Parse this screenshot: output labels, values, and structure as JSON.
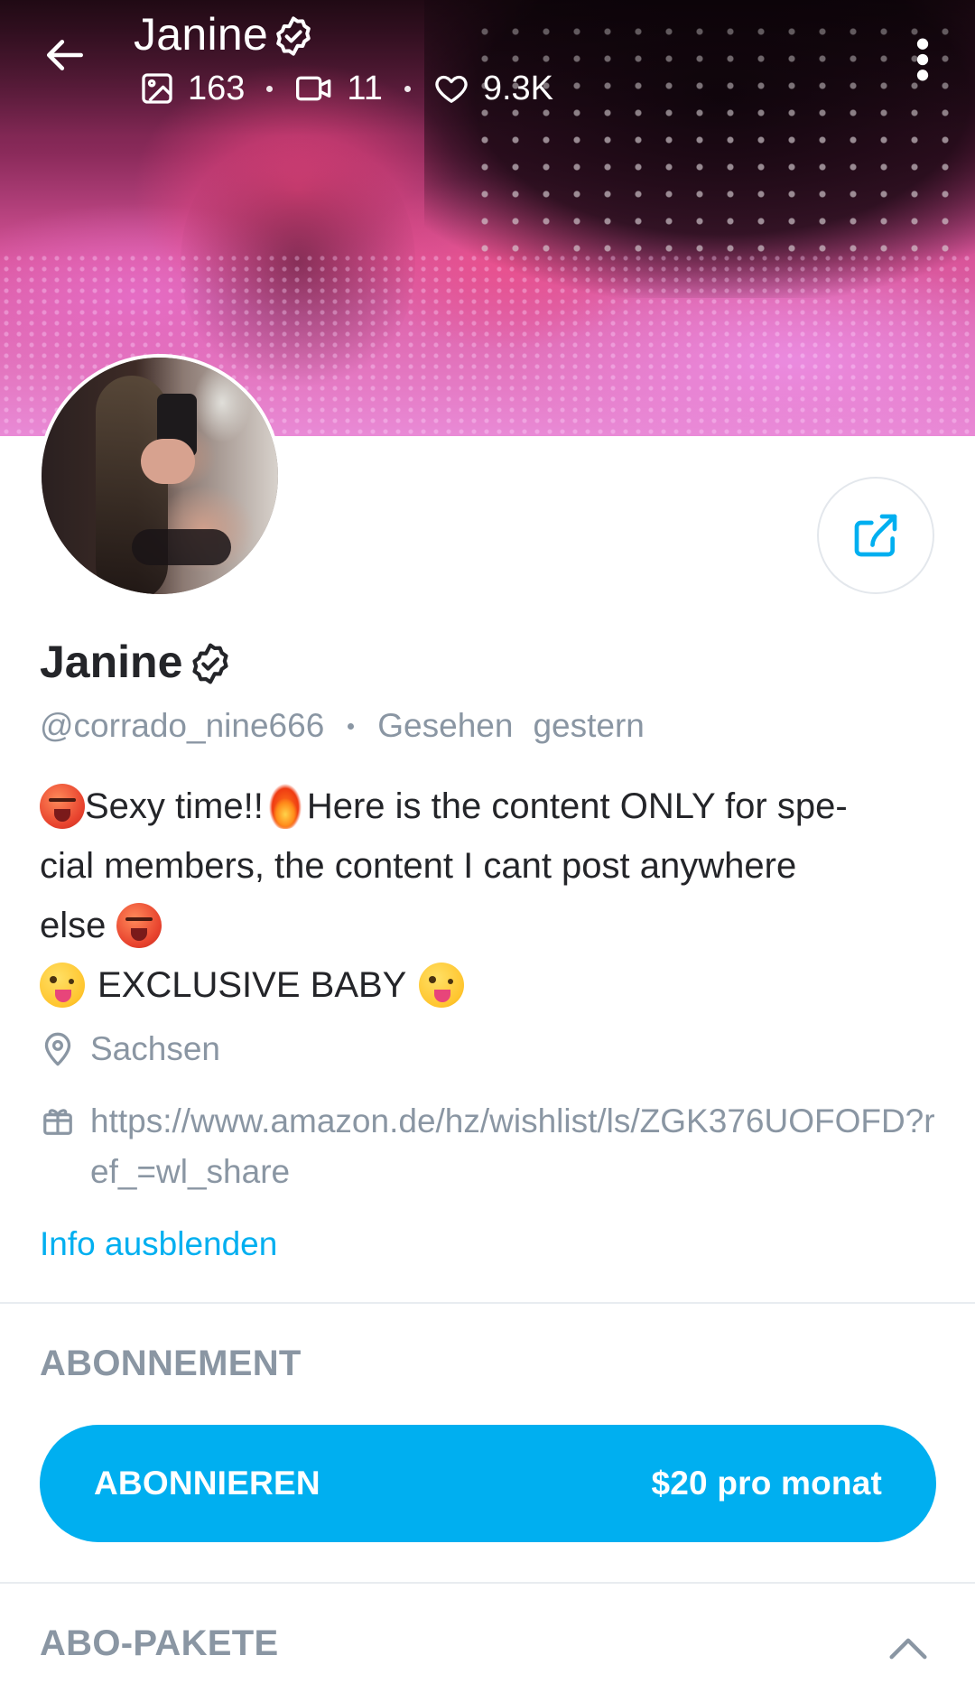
{
  "header": {
    "name": "Janine",
    "stats": {
      "photos": "163",
      "videos": "11",
      "likes": "9.3K"
    }
  },
  "profile": {
    "name": "Janine",
    "handle": "@corrado_nine666",
    "seen_label": "Gesehen",
    "seen_when": "gestern",
    "bio": {
      "line1_a": "Sexy time!!",
      "line1_b": "Here is the content ONLY for spe-",
      "line2": "cial members, the content I cant post anywhere",
      "line3": "else",
      "line4": "EXCLUSIVE BABY"
    },
    "location": "Sachsen",
    "wishlist_url": "https://www.amazon.de/hz/wishlist/ls/ZGK376UOFOFD?ref_=wl_share",
    "toggle_info_label": "Info ausblenden"
  },
  "subscription": {
    "section_title": "ABONNEMENT",
    "button_label": "ABONNIEREN",
    "price_label": "$20 pro monat"
  },
  "bundles": {
    "section_title": "ABO-PAKETE"
  },
  "colors": {
    "accent": "#00aff0",
    "muted_text": "#8a96a3",
    "primary_text": "#242529",
    "divider": "#e8ecf0"
  },
  "icons": [
    "arrow-left-icon",
    "verified-badge-icon",
    "image-icon",
    "video-icon",
    "heart-icon",
    "more-vertical-icon",
    "share-icon",
    "map-pin-icon",
    "gift-icon",
    "chevron-up-icon"
  ]
}
